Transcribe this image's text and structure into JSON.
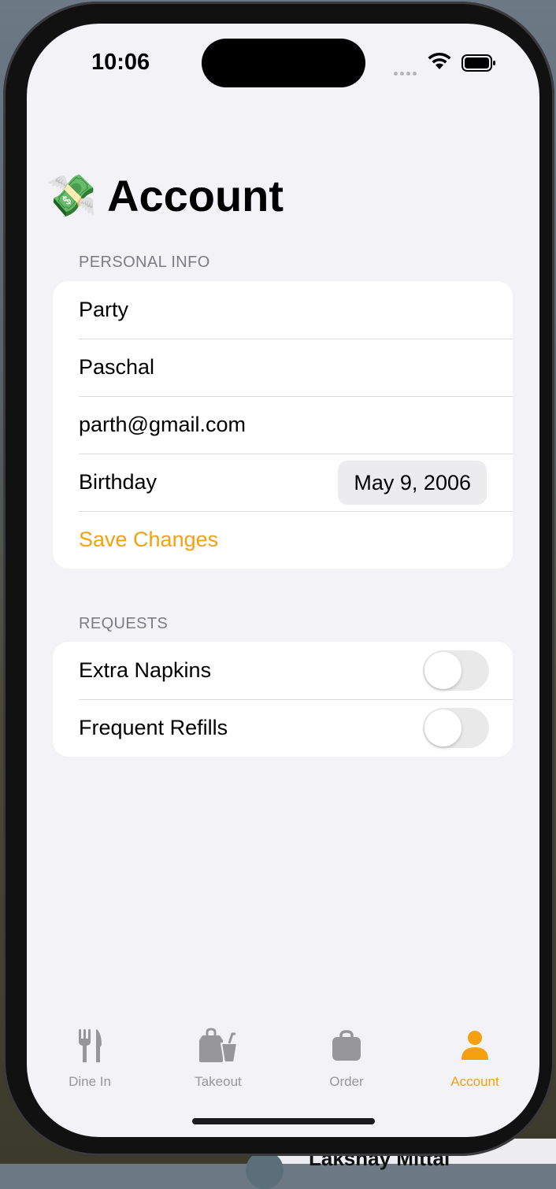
{
  "status_bar": {
    "time": "10:06"
  },
  "page": {
    "title": "Account",
    "title_emoji": "💸"
  },
  "personal_info": {
    "header": "PERSONAL INFO",
    "first_name": "Party",
    "last_name": "Paschal",
    "email": "parth@gmail.com",
    "birthday_label": "Birthday",
    "birthday_value": "May 9, 2006",
    "save_label": "Save Changes"
  },
  "requests": {
    "header": "REQUESTS",
    "items": [
      {
        "label": "Extra Napkins",
        "enabled": false
      },
      {
        "label": "Frequent Refills",
        "enabled": false
      }
    ]
  },
  "tabbar": {
    "items": [
      {
        "label": "Dine In",
        "icon": "fork-knife-icon",
        "active": false
      },
      {
        "label": "Takeout",
        "icon": "takeout-bag-icon",
        "active": false
      },
      {
        "label": "Order",
        "icon": "bag-icon",
        "active": false
      },
      {
        "label": "Account",
        "icon": "person-icon",
        "active": true
      }
    ]
  },
  "background_peek": {
    "text": "Lakshay Mittal"
  },
  "colors": {
    "accent": "#f5a00f",
    "inactive_tab": "#96969b",
    "background": "#f2f2f7"
  }
}
